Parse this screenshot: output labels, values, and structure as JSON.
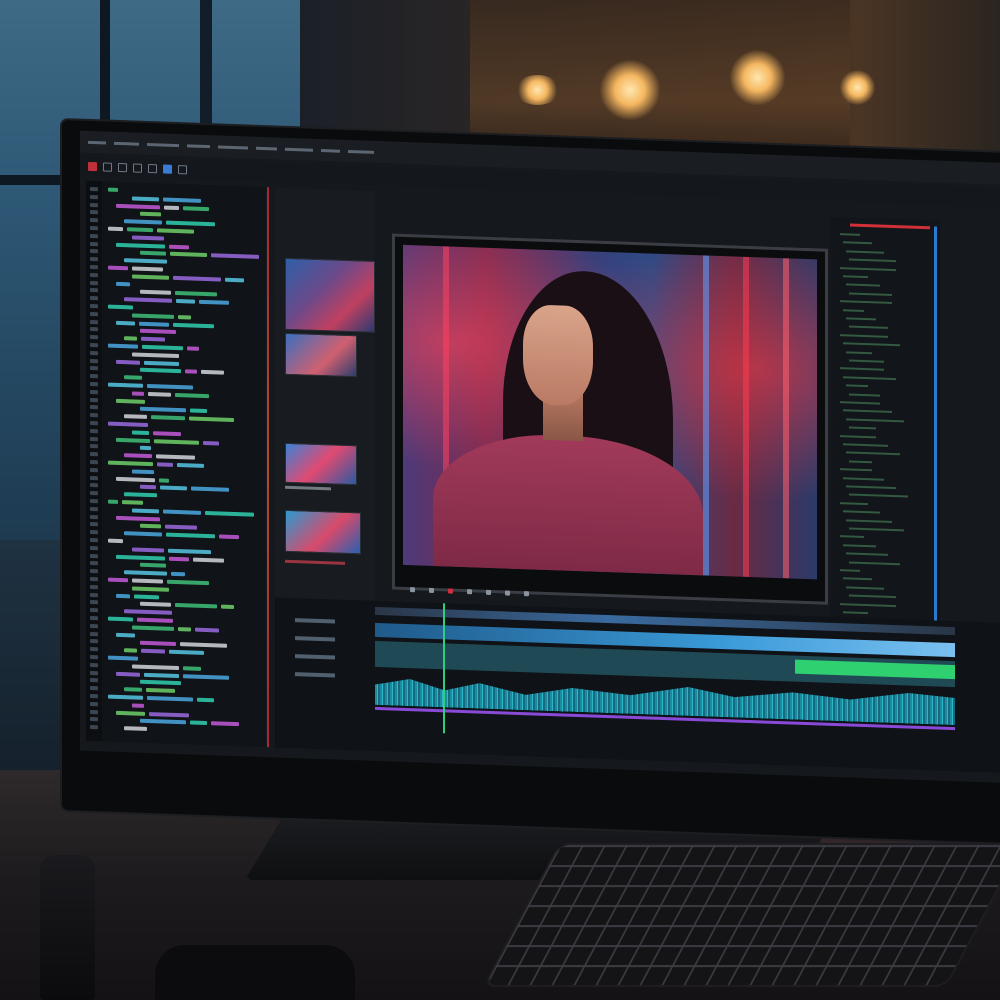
{
  "scene": {
    "description_colors": {
      "accent_red": "#d03038",
      "accent_blue": "#3a7bd5",
      "accent_green": "#2fd070",
      "accent_purple": "#8a4ad8"
    }
  },
  "monitor": {
    "app": {
      "menu_items": [
        "",
        "",
        "",
        "",
        "",
        "",
        "",
        "",
        ""
      ],
      "toolbar_icons": [
        "gear-icon",
        "folder-icon",
        "play-icon",
        "scissors-icon",
        "layers-icon",
        "grid-icon"
      ],
      "code_panel": {
        "line_count": 70
      },
      "bin_panel": {
        "header": "",
        "clips": [
          {
            "caption": ""
          },
          {
            "caption": ""
          },
          {
            "caption": ""
          },
          {
            "caption": ""
          }
        ]
      },
      "viewer": {
        "timecode": ""
      },
      "timeline": {
        "tracks": [
          "",
          "",
          "",
          "",
          ""
        ]
      }
    }
  }
}
